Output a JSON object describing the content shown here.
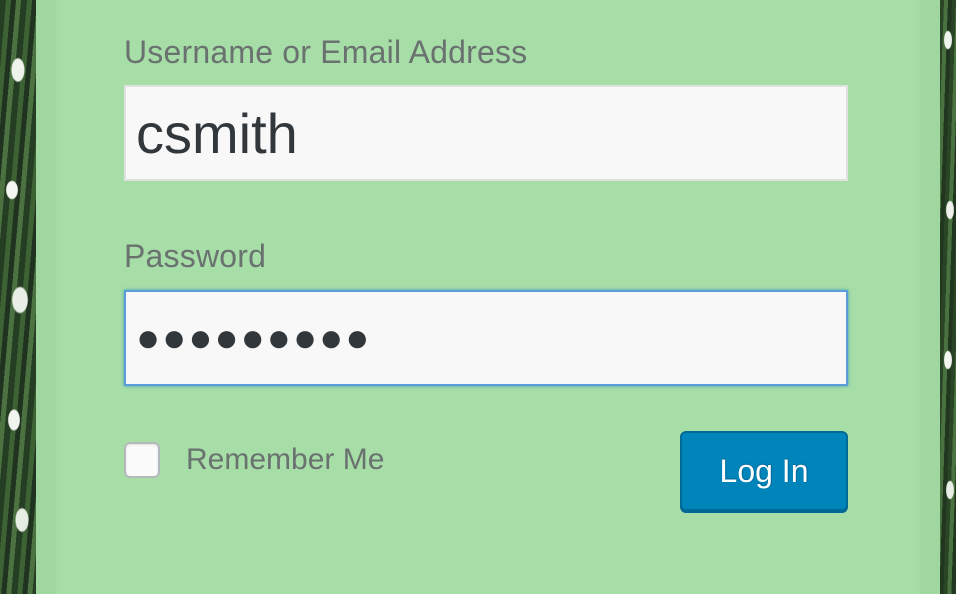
{
  "login_form": {
    "username": {
      "label": "Username or Email Address",
      "value": "csmith"
    },
    "password": {
      "label": "Password",
      "masked_value": "●●●●●●●●●"
    },
    "remember_me": {
      "label": "Remember Me",
      "checked": false
    },
    "submit_label": "Log In"
  },
  "colors": {
    "panel_background": "#a6dca6",
    "button_primary": "#0085ba",
    "focus_border": "#5b9dd9",
    "label_text": "#6a7270"
  }
}
